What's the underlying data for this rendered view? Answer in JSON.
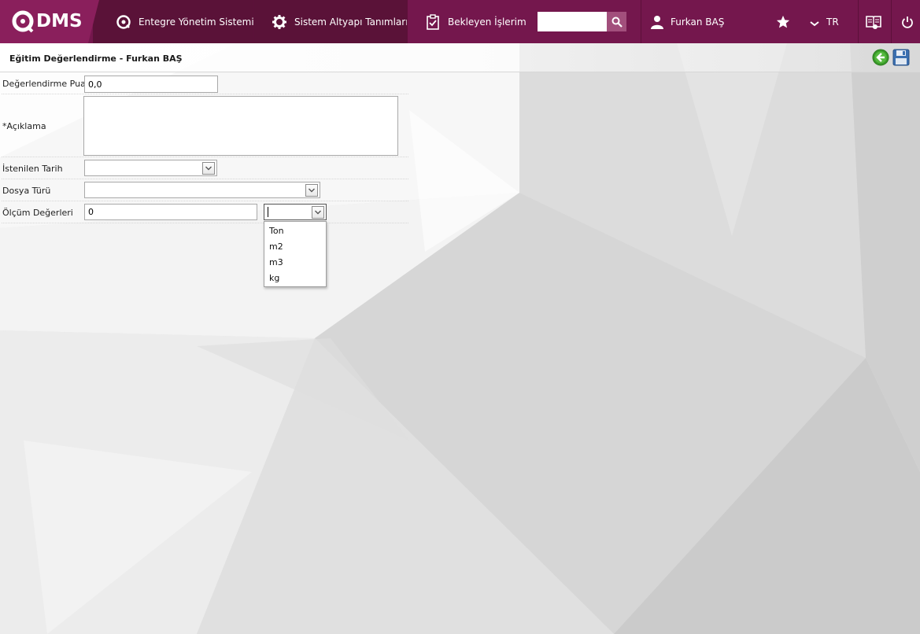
{
  "app": {
    "logo_text": "DMS",
    "nav": [
      {
        "label": "Entegre Yönetim Sistemi",
        "icon": "qdms-circle-icon"
      },
      {
        "label": "Sistem Altyapı Tanımları",
        "icon": "gear-icon"
      },
      {
        "label": "Bekleyen İşlerim",
        "icon": "clipboard-check-icon"
      }
    ],
    "search": {
      "value": "",
      "placeholder": ""
    },
    "user_name": "Furkan BAŞ",
    "language": "TR"
  },
  "page": {
    "title": "Eğitim Değerlendirme - Furkan BAŞ"
  },
  "form": {
    "score": {
      "label": "Değerlendirme Puanı",
      "value": "0,0"
    },
    "description": {
      "label": "*Açıklama",
      "value": ""
    },
    "requested_date": {
      "label": "İstenilen Tarih",
      "value": ""
    },
    "file_type": {
      "label": "Dosya Türü",
      "value": ""
    },
    "measurement": {
      "label": "Ölçüm Değerleri",
      "value": "0",
      "unit_value": "",
      "unit_options": [
        "Ton",
        "m2",
        "m3",
        "kg"
      ]
    }
  },
  "colors": {
    "topbar": "#74174d",
    "topbar_dark": "#5a1238",
    "accent": "#a24f7c"
  }
}
